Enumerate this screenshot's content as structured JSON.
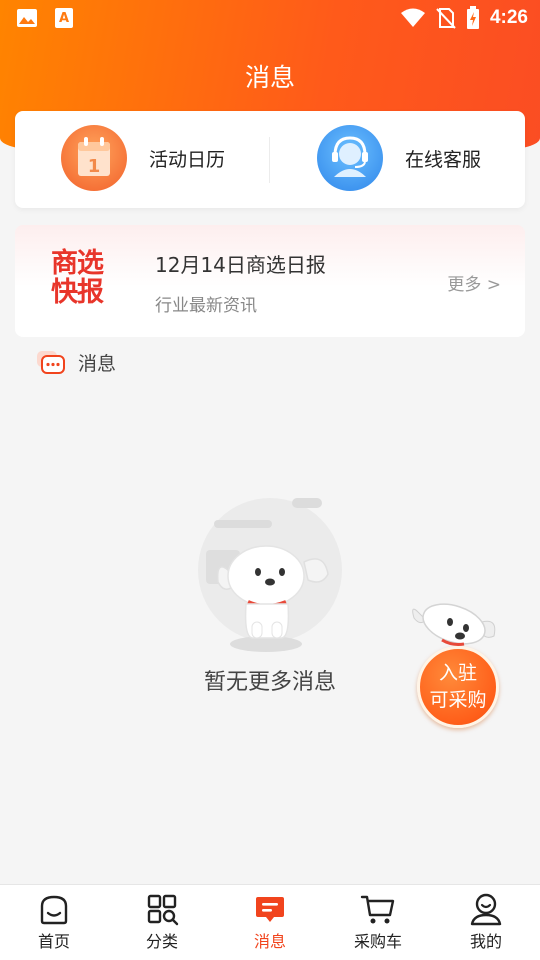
{
  "status_bar": {
    "time": "4:26",
    "icons": [
      "image-icon",
      "font-app-icon",
      "wifi-icon",
      "no-sim-icon",
      "battery-charging-icon"
    ]
  },
  "header": {
    "title": "消息"
  },
  "shortcuts": [
    {
      "label": "活动日历",
      "icon": "calendar-icon",
      "icon_text": "1"
    },
    {
      "label": "在线客服",
      "icon": "customer-service-icon"
    }
  ],
  "news": {
    "logo_line1": "商选",
    "logo_line2": "快报",
    "title": "12月14日商选日报",
    "subtitle": "行业最新资讯",
    "more": "更多  >"
  },
  "section": {
    "title": "消息",
    "icon": "chat-bubble-icon"
  },
  "empty_state": {
    "text": "暂无更多消息",
    "illustration": "joy-dog-icon"
  },
  "float_widget": {
    "line1": "入驻",
    "line2": "可采购",
    "mascot": "joy-dog-mascot-icon"
  },
  "tabs": [
    {
      "label": "首页",
      "icon": "home-icon",
      "active": false
    },
    {
      "label": "分类",
      "icon": "category-icon",
      "active": false
    },
    {
      "label": "消息",
      "icon": "message-icon",
      "active": true
    },
    {
      "label": "采购车",
      "icon": "cart-icon",
      "active": false
    },
    {
      "label": "我的",
      "icon": "profile-icon",
      "active": false
    }
  ],
  "colors": {
    "accent": "#f1441d",
    "header_start": "#ff8400",
    "header_end": "#fb4d23",
    "news_logo": "#e8352a"
  }
}
